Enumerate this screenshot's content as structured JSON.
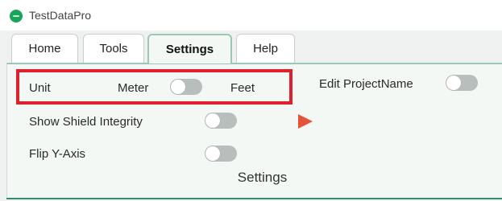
{
  "window": {
    "title": "TestDataPro",
    "logo_icon": "app-logo-icon"
  },
  "tabs": [
    {
      "label": "Home",
      "active": false
    },
    {
      "label": "Tools",
      "active": false
    },
    {
      "label": "Settings",
      "active": true
    },
    {
      "label": "Help",
      "active": false
    }
  ],
  "settings": {
    "unit": {
      "label": "Unit",
      "left_option": "Meter",
      "right_option": "Feet",
      "toggle_on": false
    },
    "edit_project_name": {
      "label": "Edit ProjectName",
      "toggle_on": false
    },
    "show_shield_integrity": {
      "label": "Show Shield Integrity",
      "toggle_on": false
    },
    "flip_y_axis": {
      "label": "Flip Y-Axis",
      "toggle_on": false
    },
    "group_label": "Settings"
  },
  "colors": {
    "accent_green": "#2f8e6c",
    "highlight_red": "#e0202c",
    "toggle_off": "#b8bebb"
  }
}
